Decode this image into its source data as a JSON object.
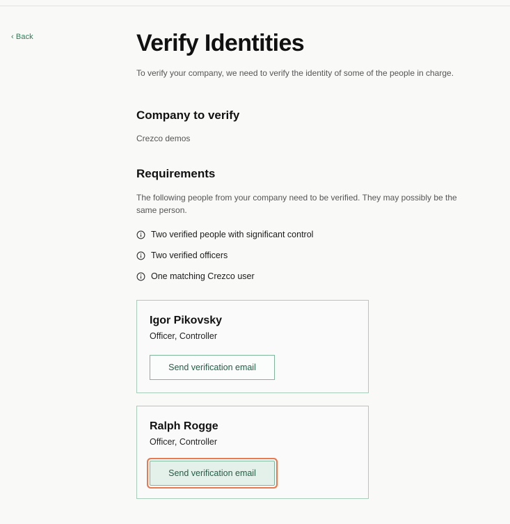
{
  "nav": {
    "back_label": "‹ Back"
  },
  "page": {
    "title": "Verify Identities",
    "intro": "To verify your company, we need to verify the identity of some of the people in charge."
  },
  "company_section": {
    "title": "Company to verify",
    "company_name": "Crezco demos"
  },
  "requirements_section": {
    "title": "Requirements",
    "description": "The following people from your company need to be verified. They may possibly be the same person.",
    "items": [
      {
        "label": "Two verified people with significant control",
        "icon": "info-icon"
      },
      {
        "label": "Two verified officers",
        "icon": "info-icon"
      },
      {
        "label": "One matching Crezco user",
        "icon": "info-icon"
      }
    ]
  },
  "people": [
    {
      "name": "Igor Pikovsky",
      "role": "Officer, Controller",
      "button_label": "Send verification email"
    },
    {
      "name": "Ralph Rogge",
      "role": "Officer, Controller",
      "button_label": "Send verification email",
      "focused": true
    }
  ],
  "colors": {
    "accent": "#2f7a58",
    "card_border": "#a9cdbb",
    "focus_ring": "#e77a4f",
    "focused_button_bg": "#e4f1ea"
  }
}
